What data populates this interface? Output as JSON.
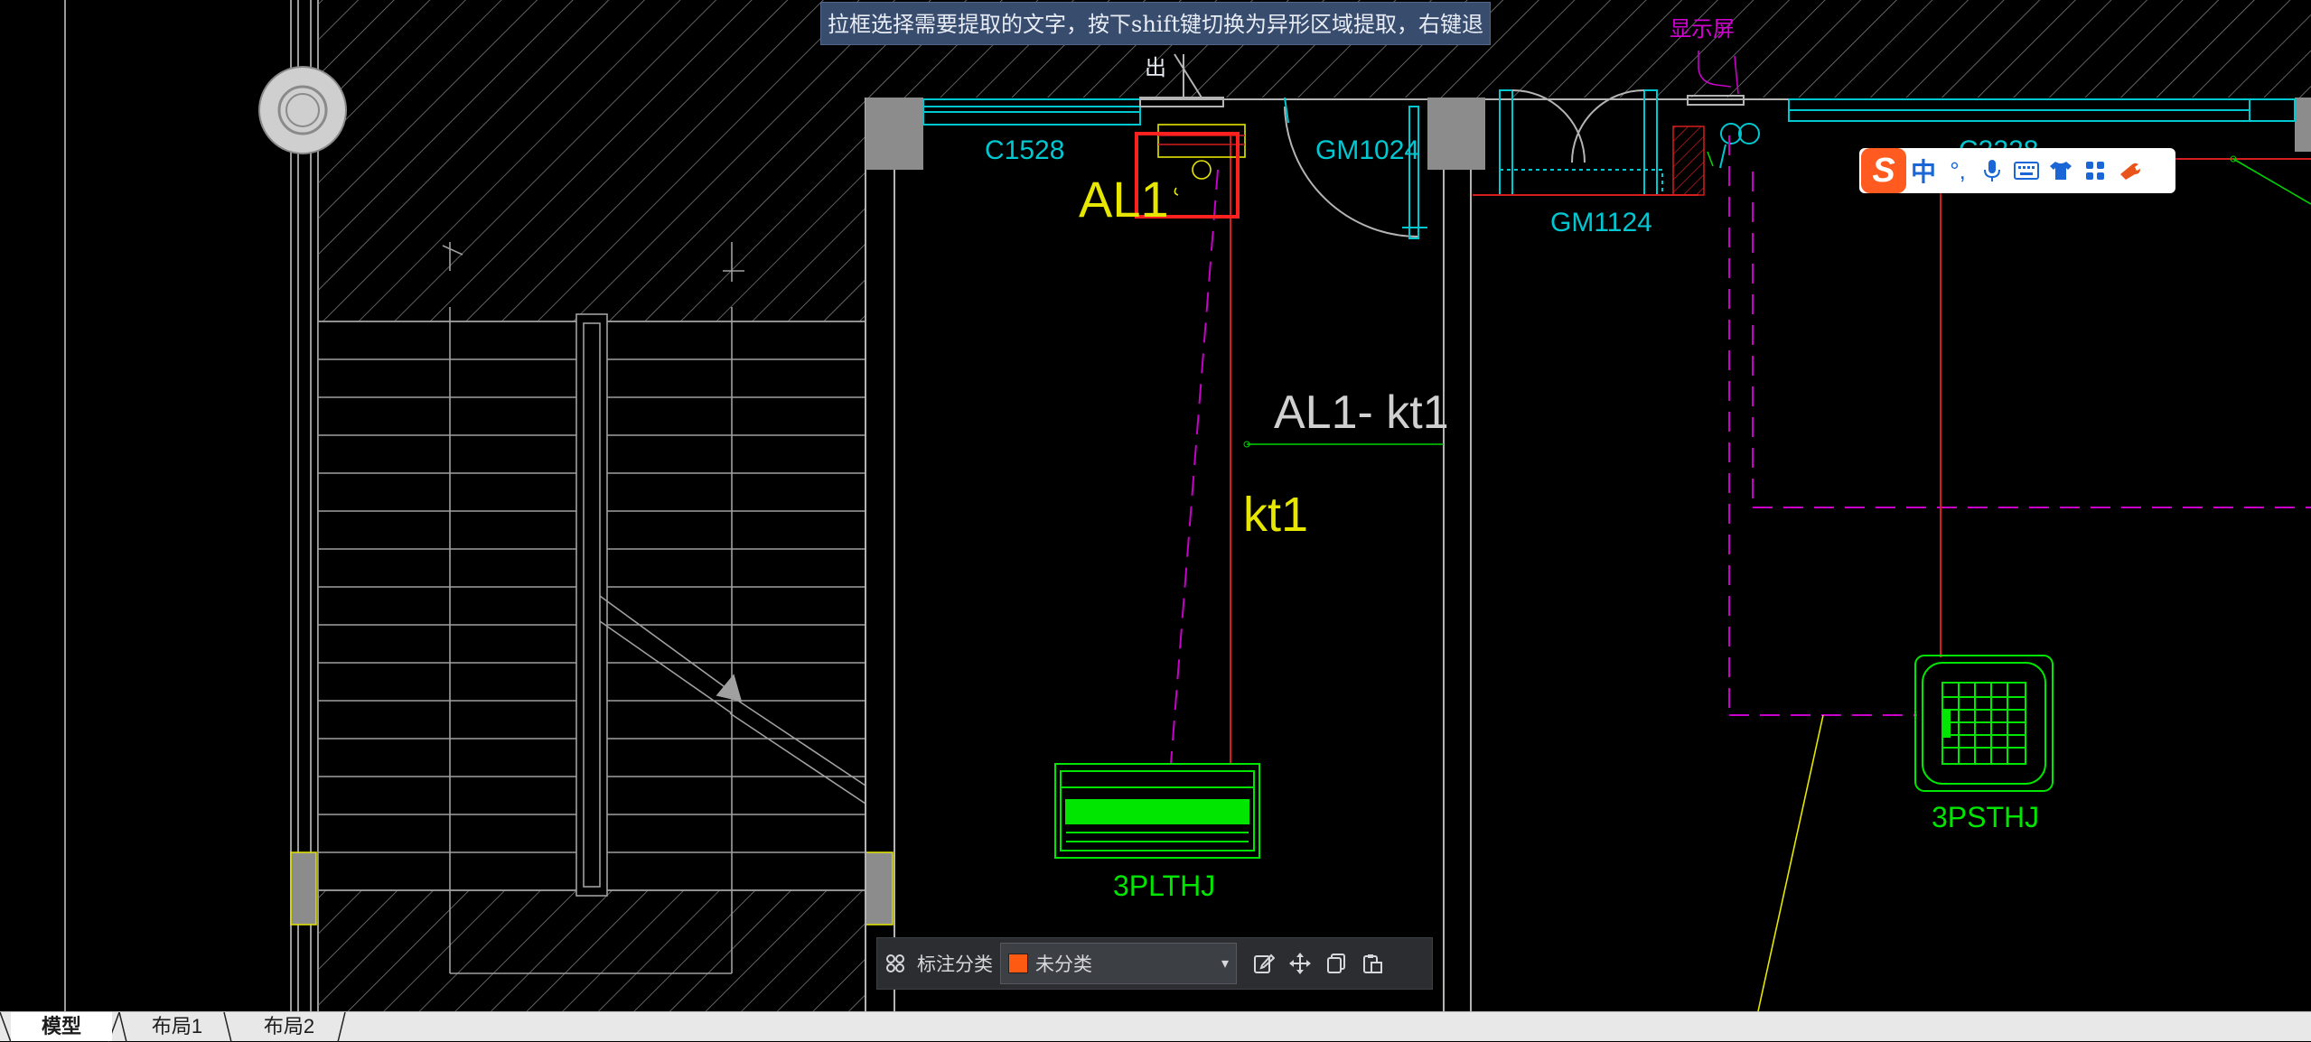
{
  "hint": {
    "text": "拉框选择需要提取的文字，按下shift键切换为异形区域提取，右键退出"
  },
  "drawing": {
    "labels": {
      "display_screen": "显示屏",
      "window_c1528": "C1528",
      "door_gm1024": "GM1024",
      "door_gm1124": "GM1124",
      "window_c3228": "C3228",
      "panel_al1": "AL1",
      "circuit_al1_kt1": "AL1- kt1",
      "circuit_kt1": "kt1",
      "unit_3plthj": "3PLTHJ",
      "unit_3psthj": "3PSTHJ"
    },
    "colors": {
      "wall_gray": "#8c8c8c",
      "cyan": "#00c8d2",
      "yellow": "#e6e600",
      "green": "#00e600",
      "magenta": "#d200d2",
      "red": "#d21e1e",
      "selection_red": "#ff2020"
    }
  },
  "ime": {
    "logo": "S",
    "chinese": "中",
    "punct": "°,",
    "icons": [
      "microphone-icon",
      "keyboard-icon",
      "skin-icon",
      "apps-icon",
      "wrench-icon"
    ]
  },
  "toolbar": {
    "category_label": "标注分类",
    "selected_category": "未分类",
    "swatch_color": "#ff5a12"
  },
  "tabs": [
    {
      "label": "模型",
      "active": true
    },
    {
      "label": "布局1",
      "active": false
    },
    {
      "label": "布局2",
      "active": false
    }
  ]
}
